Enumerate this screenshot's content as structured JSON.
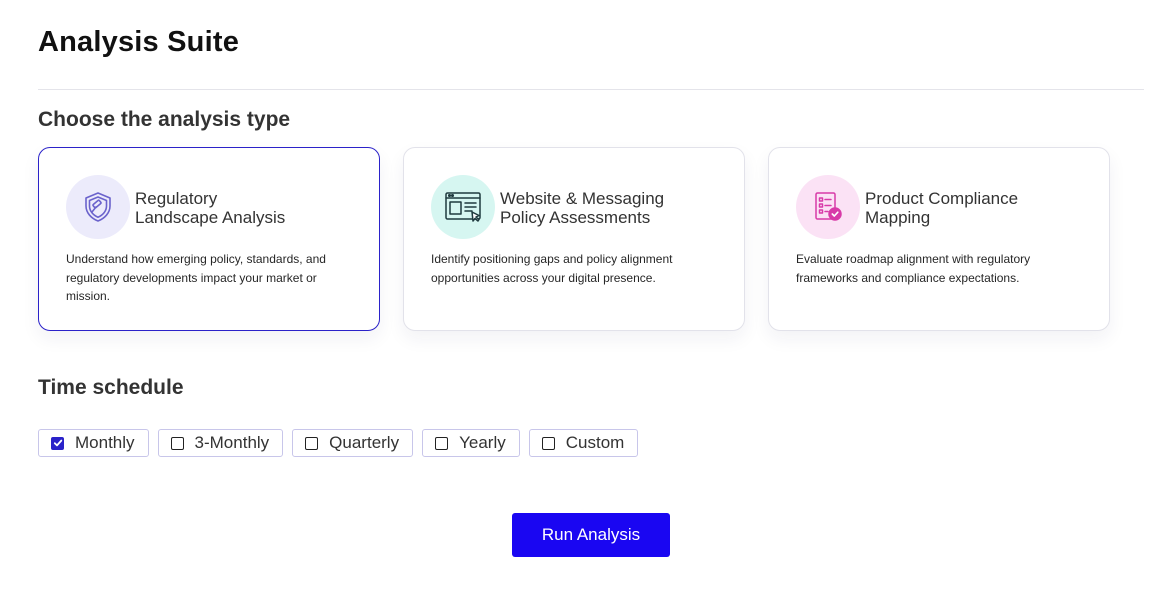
{
  "page": {
    "title": "Analysis Suite"
  },
  "analysis_type": {
    "heading": "Choose the analysis type",
    "cards": [
      {
        "title_line1": "Regulatory",
        "title_line2": "Landscape Analysis",
        "description": "Understand how emerging policy, standards, and regulatory developments impact your market or mission.",
        "icon": "shield-gavel-icon",
        "selected": true
      },
      {
        "title_line1": "Website & Messaging",
        "title_line2": "Policy Assessments",
        "description": "Identify positioning gaps and policy alignment opportunities across your digital presence.",
        "icon": "browser-document-icon",
        "selected": false
      },
      {
        "title_line1": "Product Compliance",
        "title_line2": "Mapping",
        "description": "Evaluate roadmap alignment with regulatory frameworks and compliance expectations.",
        "icon": "checklist-badge-icon",
        "selected": false
      }
    ]
  },
  "time_schedule": {
    "heading": "Time schedule",
    "options": [
      {
        "label": "Monthly",
        "checked": true
      },
      {
        "label": "3-Monthly",
        "checked": false
      },
      {
        "label": "Quarterly",
        "checked": false
      },
      {
        "label": "Yearly",
        "checked": false
      },
      {
        "label": "Custom",
        "checked": false
      }
    ]
  },
  "actions": {
    "run_label": "Run Analysis"
  },
  "colors": {
    "accent": "#1a06f2",
    "selected_border": "#2b22c9",
    "icon_bg_1": "#ecebfb",
    "icon_bg_2": "#d6f6f1",
    "icon_bg_3": "#fbe2f5"
  }
}
